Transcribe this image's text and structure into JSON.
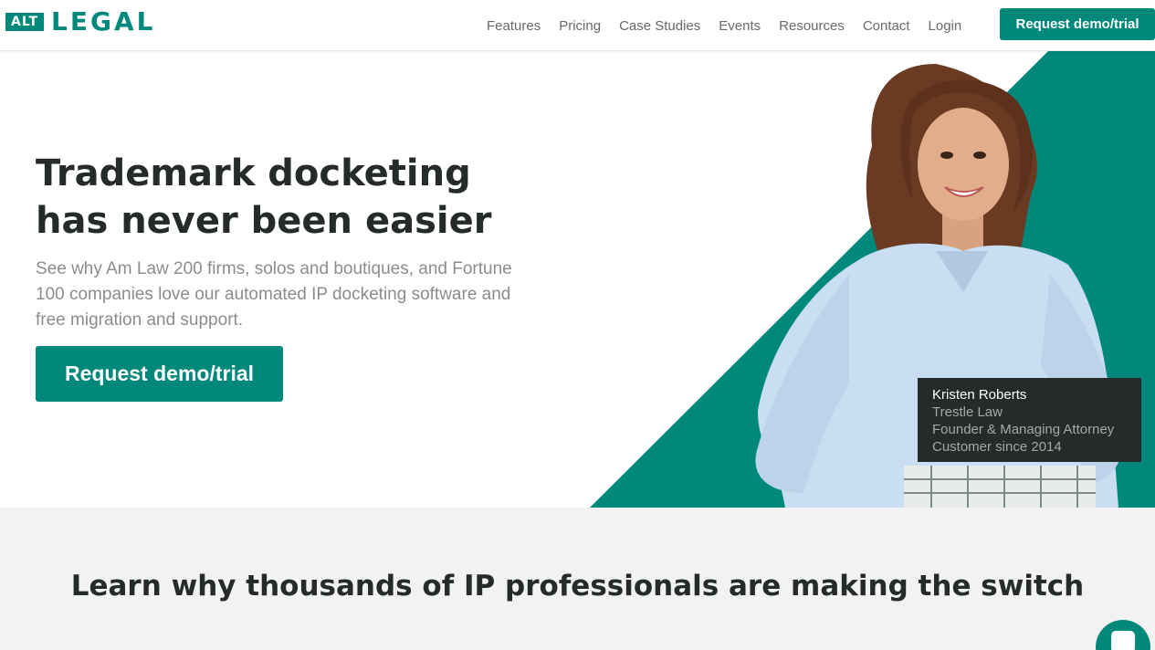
{
  "header": {
    "logo": {
      "badge": "ALT",
      "word": "LEGAL"
    },
    "nav": [
      "Features",
      "Pricing",
      "Case Studies",
      "Events",
      "Resources",
      "Contact",
      "Login"
    ],
    "cta_label": "Request demo/trial"
  },
  "hero": {
    "title_line1": "Trademark docketing",
    "title_line2": "has never been easier",
    "subtitle": "See why Am Law 200 firms, solos and boutiques, and Fortune 100 companies love our automated IP docketing software and free migration and support.",
    "cta_label": "Request demo/trial",
    "testimonial": {
      "name": "Kristen Roberts",
      "firm": "Trestle Law",
      "role": "Founder & Managing Attorney",
      "since": "Customer since 2014"
    }
  },
  "section": {
    "heading": "Learn why thousands of IP professionals are making the switch"
  },
  "colors": {
    "brand": "#00897b",
    "dark": "#252a2b",
    "gray_section": "#f2f2f2"
  },
  "icons": {
    "chat": "chat-icon"
  }
}
